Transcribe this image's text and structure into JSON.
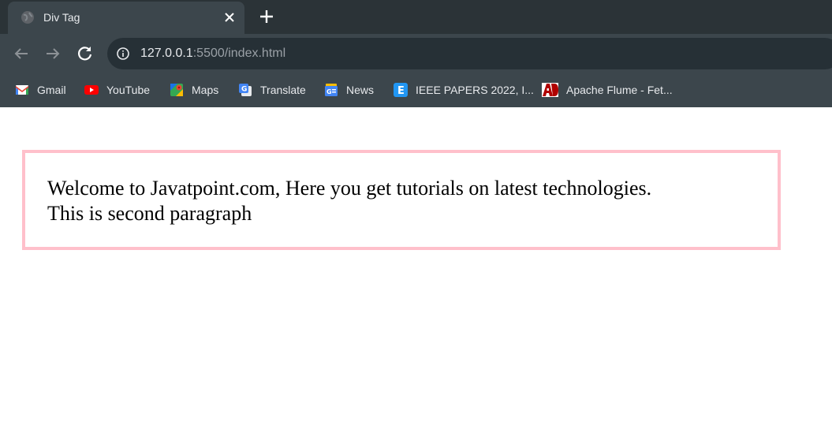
{
  "browser": {
    "tab": {
      "title": "Div Tag",
      "favicon_icon": "globe-icon",
      "close_icon": "close-icon"
    },
    "new_tab_icon": "plus-icon",
    "toolbar": {
      "back_icon": "arrow-left-icon",
      "forward_icon": "arrow-right-icon",
      "reload_icon": "reload-icon",
      "site_info_icon": "info-icon",
      "url_host": "127.0.0.1",
      "url_rest": ":5500/index.html"
    },
    "bookmarks": [
      {
        "label": "Gmail",
        "icon": "gmail-icon"
      },
      {
        "label": "YouTube",
        "icon": "youtube-icon"
      },
      {
        "label": "Maps",
        "icon": "maps-icon"
      },
      {
        "label": "Translate",
        "icon": "translate-icon"
      },
      {
        "label": "News",
        "icon": "news-icon"
      },
      {
        "label": "IEEE PAPERS 2022, I...",
        "icon": "e-badge-icon"
      },
      {
        "label": "Apache Flume - Fet...",
        "icon": "ad-logo-icon"
      }
    ]
  },
  "page": {
    "paragraph_1": "Welcome to Javatpoint.com, Here you get tutorials on latest technologies.",
    "paragraph_2": "This is second paragraph",
    "box_border_color": "#ffc0cb"
  }
}
